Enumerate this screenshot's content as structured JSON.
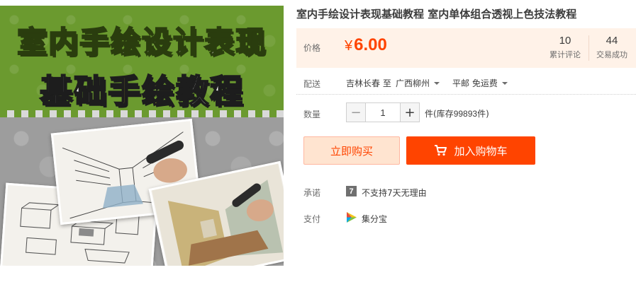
{
  "product": {
    "title": "室内手绘设计表现基础教程 室内单体组合透视上色技法教程",
    "image": {
      "banner_line1": "室内手绘设计表现",
      "banner_line2_left": "基础",
      "banner_line2_accent": "手绘",
      "banner_line2_right": "教程",
      "banner_accent_color": "#f2ec2c",
      "banner_bg_color": "#6b9a2f"
    }
  },
  "price": {
    "label": "价格",
    "currency": "¥",
    "value": "6.00",
    "color": "#ff4400"
  },
  "stats": {
    "reviews_count": "10",
    "reviews_label": "累计评论",
    "sales_count": "44",
    "sales_label": "交易成功"
  },
  "shipping": {
    "label": "配送",
    "from": "吉林长春 至",
    "to": "广西柳州",
    "method": "平邮 免运费"
  },
  "quantity": {
    "label": "数量",
    "value": "1",
    "minus": "−",
    "plus": "+",
    "stock_prefix": "件(库存",
    "stock_count": "99893",
    "stock_suffix": "件)"
  },
  "actions": {
    "buy_now": "立即购买",
    "add_to_cart": "加入购物车",
    "cart_icon": "shopping-cart-icon"
  },
  "promise": {
    "label": "承诺",
    "icon_text": "7",
    "text": "不支持7天无理由"
  },
  "payment": {
    "label": "支付",
    "icon": "jifenbao-icon",
    "text": "集分宝"
  }
}
